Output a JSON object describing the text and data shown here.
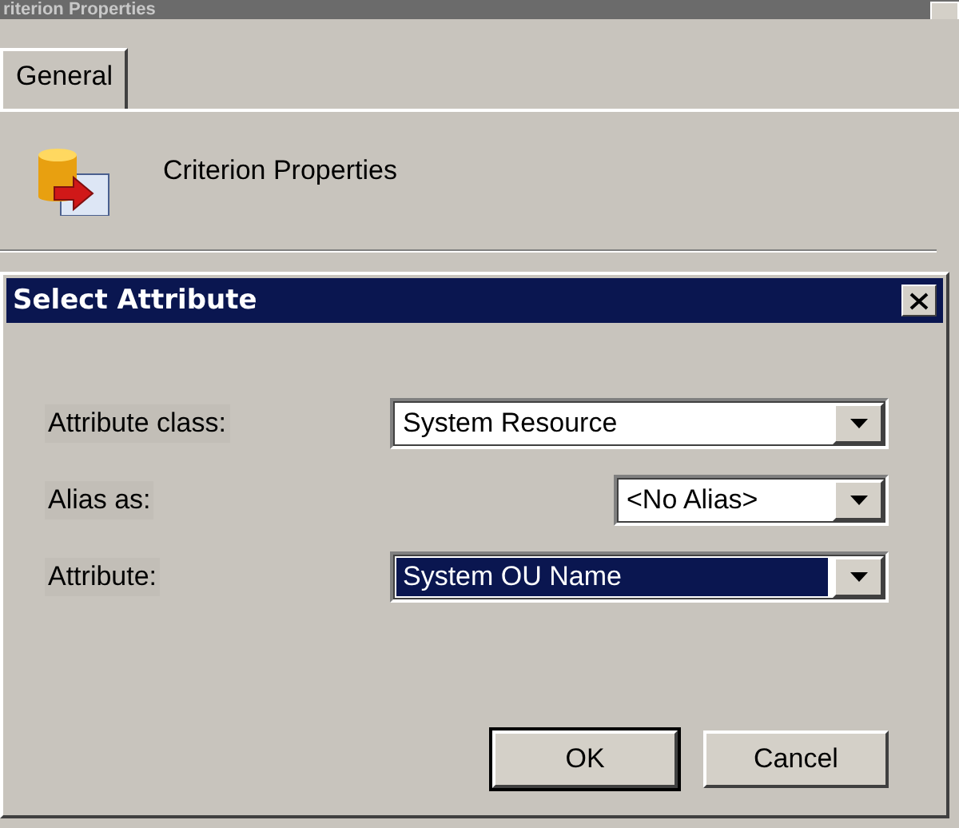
{
  "background_window": {
    "title": "riterion Properties",
    "tabs": [
      {
        "label": "General",
        "selected": true
      }
    ],
    "header_text": "Criterion Properties"
  },
  "dialog": {
    "title": "Select Attribute",
    "fields": [
      {
        "label": "Attribute class:",
        "value": "System Resource",
        "focused": false
      },
      {
        "label": "Alias as:",
        "value": "<No Alias>",
        "focused": false
      },
      {
        "label": "Attribute:",
        "value": "System OU Name",
        "focused": true
      }
    ],
    "buttons": [
      {
        "label": "OK",
        "default": true
      },
      {
        "label": "Cancel",
        "default": false
      }
    ]
  }
}
